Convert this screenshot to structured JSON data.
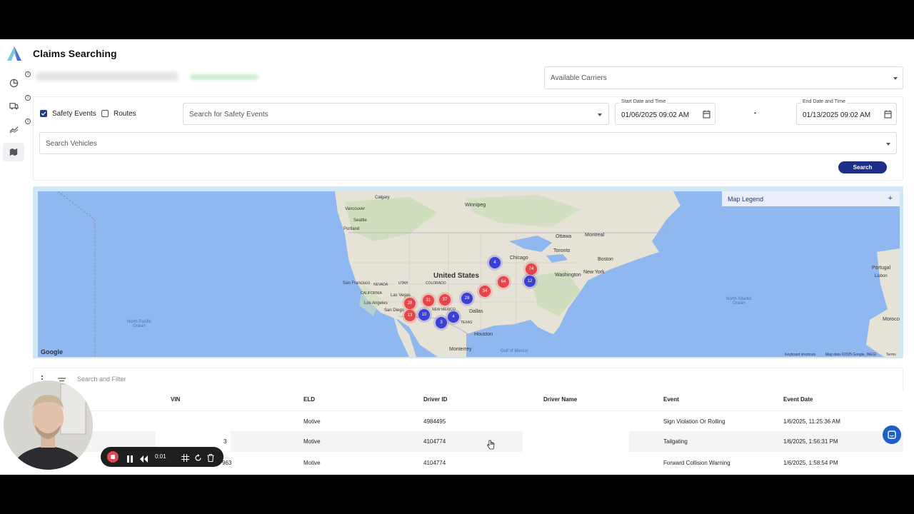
{
  "page": {
    "title": "Claims Searching"
  },
  "filters": {
    "carriers_placeholder": "Available Carriers",
    "safety_events_label": "Safety Events",
    "safety_events_checked": true,
    "routes_label": "Routes",
    "routes_checked": false,
    "events_placeholder": "Search for Safety Events",
    "start_label": "Start Date and Time",
    "start_value": "01/06/2025 09:02 AM",
    "range_separator": "-",
    "end_label": "End Date and Time",
    "end_value": "01/13/2025 09:02 AM",
    "vehicles_placeholder": "Search Vehicles",
    "search_button": "Search"
  },
  "map": {
    "legend_title": "Map Legend",
    "legend_toggle": "+",
    "labels": {
      "winnipeg": "Winnipeg",
      "vancouver": "Vancouver",
      "seattle": "Seattle",
      "portland": "Portland",
      "calgary": "Calgary",
      "united_states": "United States",
      "san_francisco": "San Francisco",
      "california": "CALIFORNIA",
      "las_vegas": "Las Vegas",
      "los_angeles": "Los Angeles",
      "san_diego": "San Diego",
      "nevada": "NEVADA",
      "utah": "UTAH",
      "colorado": "COLORADO",
      "new_mexico": "NEW MEXICO",
      "texas": "TEXAS",
      "dallas": "Dallas",
      "houston": "Houston",
      "monterrey": "Monterrey",
      "chicago": "Chicago",
      "ottawa": "Ottawa",
      "montreal": "Montreal",
      "toronto": "Toronto",
      "boston": "Boston",
      "washington": "Washington",
      "new_york": "New York",
      "north_pacific_ocean": "North Pacific Ocean",
      "north_atlantic_ocean": "North Atlantic Ocean",
      "gulf_of_mexico": "Gulf of Mexico",
      "portugal": "Portugal",
      "lisbon": "Lisbon",
      "morocco": "Morocco",
      "google": "Google",
      "keyboard_shortcuts": "Keyboard shortcuts",
      "map_data": "Map data ©2025 Google, INEGI",
      "terms": "Terms"
    },
    "clusters": [
      {
        "count": "4",
        "color": "blue"
      },
      {
        "count": "74",
        "color": "red"
      },
      {
        "count": "64",
        "color": "red"
      },
      {
        "count": "12",
        "color": "blue"
      },
      {
        "count": "34",
        "color": "red"
      },
      {
        "count": "28",
        "color": "blue"
      },
      {
        "count": "37",
        "color": "red"
      },
      {
        "count": "31",
        "color": "red"
      },
      {
        "count": "28",
        "color": "red"
      },
      {
        "count": "10",
        "color": "blue"
      },
      {
        "count": "13",
        "color": "red"
      },
      {
        "count": "4",
        "color": "blue"
      },
      {
        "count": "3",
        "color": "blue"
      }
    ],
    "colors": {
      "red": "#e8454a",
      "blue": "#3a3fd6"
    }
  },
  "table": {
    "search_placeholder": "Search and Filter",
    "columns": [
      "VIN",
      "ELD",
      "Driver ID",
      "Driver Name",
      "Event",
      "Event Date"
    ],
    "rows": [
      {
        "vin": "",
        "eld": "Motive",
        "driver_id": "4984495",
        "driver_name": "",
        "event": "Sign Violation Or Rolling",
        "event_date": "1/6/2025, 11:25:36 AM"
      },
      {
        "vin": "3",
        "eld": "Motive",
        "driver_id": "4104774",
        "driver_name": "",
        "event": "Tailgating",
        "event_date": "1/6/2025, 1:56:31 PM"
      },
      {
        "vin": "963",
        "eld": "Motive",
        "driver_id": "4104774",
        "driver_name": "",
        "event": "Forward Collision Warning",
        "event_date": "1/6/2025, 1:58:54 PM"
      }
    ]
  },
  "recorder": {
    "time": "0:01"
  },
  "colors": {
    "accent": "#1e2f8a",
    "checkbox": "#1e3a8a"
  }
}
